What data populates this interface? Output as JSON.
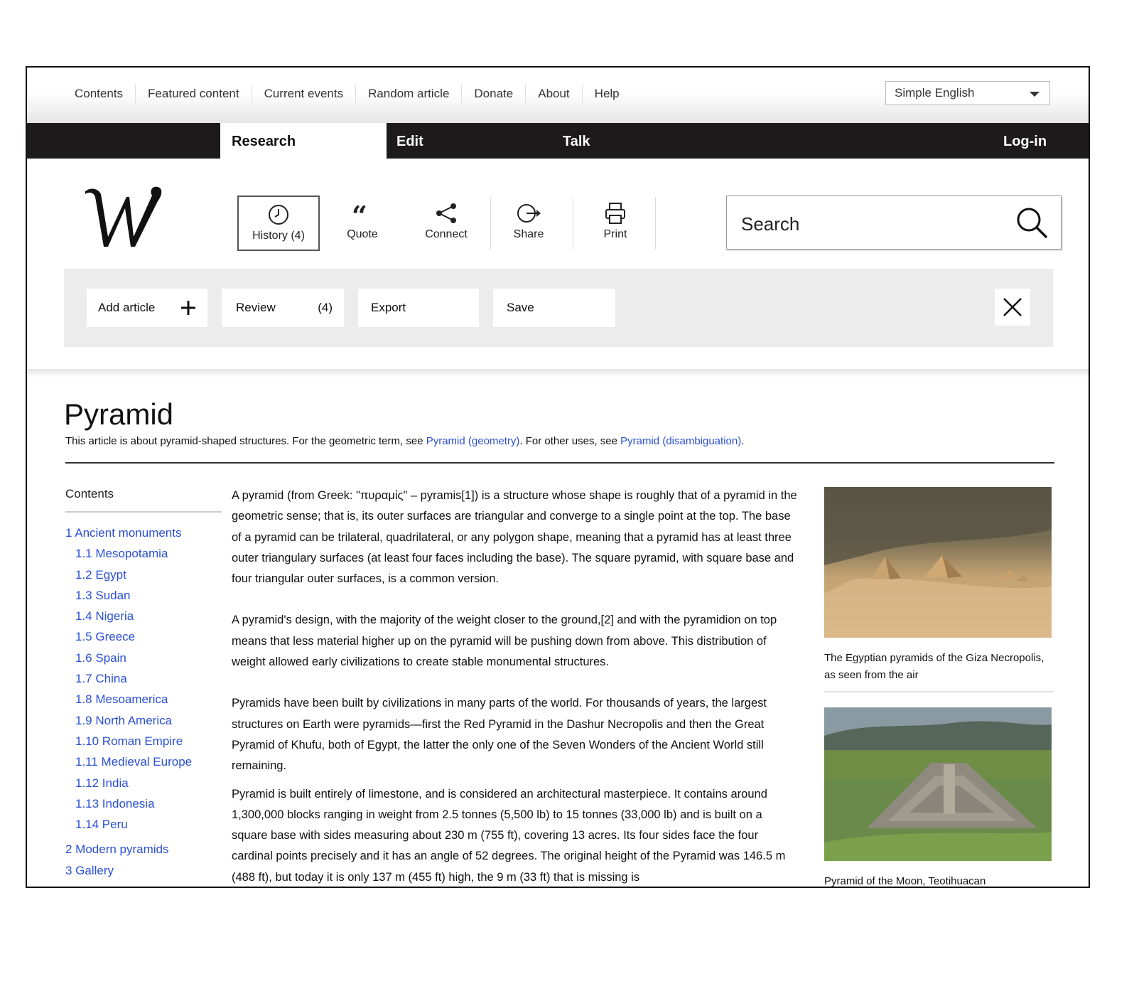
{
  "top_links": [
    "Contents",
    "Featured content",
    "Current events",
    "Random article",
    "Donate",
    "About",
    "Help"
  ],
  "language": "Simple English",
  "nav": {
    "research": "Research",
    "edit": "Edit",
    "talk": "Talk",
    "login": "Log-in"
  },
  "tools": {
    "history": "History (4)",
    "quote": "Quote",
    "connect": "Connect",
    "share": "Share",
    "print": "Print"
  },
  "search": {
    "placeholder": "Search"
  },
  "actions": {
    "add_article": "Add article",
    "review": "Review",
    "review_count": "(4)",
    "export": "Export",
    "save": "Save"
  },
  "article": {
    "title": "Pyramid",
    "hatnote_prefix": "This article is about pyramid-shaped structures. For the geometric term, see ",
    "hatnote_link1": "Pyramid (geometry)",
    "hatnote_mid": ". For other uses, see ",
    "hatnote_link2": "Pyramid (disambiguation)",
    "hatnote_suffix": ".",
    "paragraphs": [
      "A pyramid (from Greek: \"πυραμίς\" – pyramis[1]) is a structure whose shape is roughly that of a pyramid in the geometric sense; that is, its outer surfaces are triangular and converge to a single point at the top. The base of a pyramid can be trilateral, quadrilateral, or any polygon shape, meaning that a pyramid has at least three outer triangulary surfaces (at least four faces including the base). The square pyramid, with square base and four triangular outer surfaces, is a common version.",
      "A pyramid's design, with the majority of the weight closer to the ground,[2] and with the pyramidion on top means that less material higher up on the pyramid will be pushing down from above. This distribution of weight allowed early civilizations to create stable monumental structures.",
      "Pyramids have been built by civilizations in many parts of the world. For thousands of years, the largest structures on Earth were pyramids—first the Red Pyramid in the Dashur Necropolis and then the Great Pyramid of Khufu, both of Egypt, the latter the only one of the Seven Wonders of the Ancient World still remaining.",
      "Pyramid is built entirely of limestone, and is considered an architectural masterpiece. It contains around 1,300,000 blocks ranging in weight from 2.5 tonnes (5,500 lb) to 15 tonnes (33,000 lb) and is built on a  square base with sides measuring about 230 m (755 ft), covering 13 acres. Its four sides face the four cardinal points precisely and it has an angle of 52 degrees. The original height of the Pyramid was 146.5 m (488 ft), but today it is only 137 m (455 ft) high, the 9 m (33 ft) that is missing is"
    ]
  },
  "toc": {
    "title": "Contents",
    "items": [
      "1 Ancient monuments",
      "1.1 Mesopotamia",
      "1.2 Egypt",
      "1.3 Sudan",
      "1.4 Nigeria",
      "1.5 Greece",
      "1.6 Spain",
      "1.7 China",
      "1.8 Mesoamerica",
      "1.9 North America",
      "1.10 Roman Empire",
      "1.11 Medieval Europe",
      "1.12 India",
      "1.13 Indonesia",
      "1.14 Peru",
      "2 Modern pyramids",
      "3 Gallery"
    ]
  },
  "figures": [
    {
      "caption": "The Egyptian pyramids of the Giza Necropolis, as seen from the air"
    },
    {
      "caption": "Pyramid of the Moon, Teotihuacan"
    }
  ],
  "colors": {
    "link": "#2a4fd4",
    "nav_bg": "#1c1a1a",
    "panel_bg": "#ececec"
  }
}
